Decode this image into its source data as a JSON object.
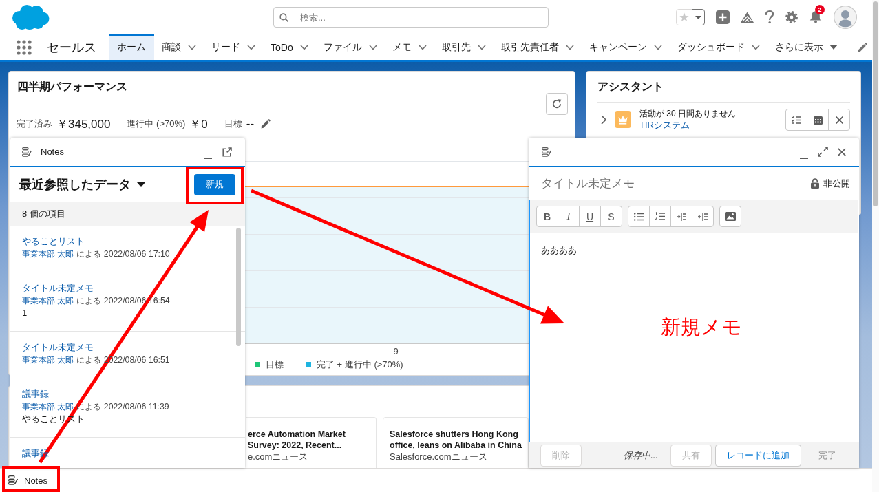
{
  "header": {
    "search": {
      "placeholder": "検索..."
    },
    "notifications": "2"
  },
  "nav": {
    "app_name": "セールス",
    "tabs": [
      {
        "label": "ホーム",
        "selected": true,
        "has_menu": false
      },
      {
        "label": "商談",
        "selected": false,
        "has_menu": true
      },
      {
        "label": "リード",
        "selected": false,
        "has_menu": true
      },
      {
        "label": "ToDo",
        "selected": false,
        "has_menu": true
      },
      {
        "label": "ファイル",
        "selected": false,
        "has_menu": true
      },
      {
        "label": "メモ",
        "selected": false,
        "has_menu": true
      },
      {
        "label": "取引先",
        "selected": false,
        "has_menu": true
      },
      {
        "label": "取引先責任者",
        "selected": false,
        "has_menu": true
      },
      {
        "label": "キャンペーン",
        "selected": false,
        "has_menu": true
      },
      {
        "label": "ダッシュボード",
        "selected": false,
        "has_menu": true
      }
    ],
    "more": "さらに表示"
  },
  "performance": {
    "title": "四半期パフォーマンス",
    "stats": [
      {
        "label": "完了済み",
        "value": "￥345,000"
      },
      {
        "label": "進行中 (>70%)",
        "value": "￥0"
      },
      {
        "label": "目標",
        "value": "--"
      }
    ],
    "x_tick": "9",
    "legend": [
      {
        "label": "目標",
        "color": "#1ec677"
      },
      {
        "label": "完了 + 進行中 (>70%)",
        "color": "#1eb4e0"
      }
    ]
  },
  "news": [
    {
      "title": "erce Automation Market Survey: 2022, Recent...",
      "source": "e.comニュース"
    },
    {
      "title": "Salesforce shutters Hong Kong office, leans on Alibaba in China",
      "source": "Salesforce.comニュース"
    }
  ],
  "assistant": {
    "title": "アシスタント",
    "items": [
      {
        "message": "活動が 30 日間ありません",
        "account": "HRシステム"
      }
    ]
  },
  "notes_panel": {
    "title": "Notes",
    "list_view": "最近参照したデータ",
    "new_button": "新規",
    "count": "8 個の項目",
    "notes": [
      {
        "title": "やることリスト",
        "author": "事業本部 太郎",
        "byline": "による 2022/08/06 17:10"
      },
      {
        "title": "タイトル未定メモ",
        "author": "事業本部 太郎",
        "byline": "による 2022/08/06 16:54",
        "preview": "1"
      },
      {
        "title": "タイトル未定メモ",
        "author": "事業本部 太郎",
        "byline": "による 2022/08/06 16:51"
      },
      {
        "title": "議事録",
        "author": "事業本部 太郎",
        "byline": "による 2022/08/06 11:39",
        "preview": "やることリスト"
      },
      {
        "title": "議事録"
      }
    ]
  },
  "note_editor": {
    "title": {
      "placeholder": "タイトル未定メモ"
    },
    "visibility": "非公開",
    "toolbar": [
      {
        "buttons": [
          {
            "kind": "bold",
            "label": "B"
          },
          {
            "kind": "italic",
            "label": "I"
          },
          {
            "kind": "underline",
            "label": "U"
          },
          {
            "kind": "strike",
            "label": "S"
          }
        ]
      },
      {
        "buttons": [
          {
            "kind": "bullets"
          },
          {
            "kind": "numbers"
          },
          {
            "kind": "indent"
          },
          {
            "kind": "outdent"
          }
        ]
      },
      {
        "buttons": [
          {
            "kind": "image"
          }
        ]
      }
    ],
    "body": "ああああ",
    "footer": [
      {
        "kind": "delete",
        "label": "削除",
        "disabled": true
      },
      {
        "kind": "status",
        "label": "保存中..."
      },
      {
        "kind": "share",
        "label": "共有",
        "disabled": true
      },
      {
        "kind": "add",
        "label": "レコードに追加",
        "disabled": false
      },
      {
        "kind": "done",
        "label": "完了",
        "disabled": true
      }
    ]
  },
  "utility_bar": {
    "items": [
      {
        "label": "Notes"
      }
    ]
  },
  "annotation": {
    "label": "新規メモ"
  }
}
